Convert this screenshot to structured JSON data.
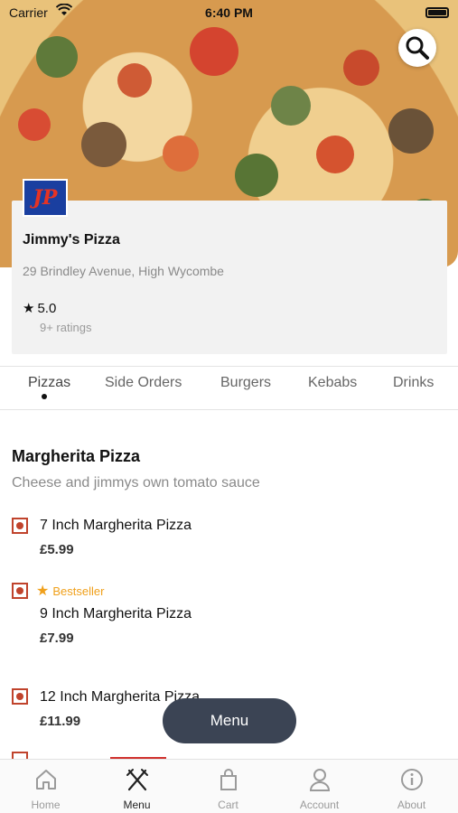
{
  "status_bar": {
    "carrier": "Carrier",
    "time": "6:40 PM"
  },
  "hero": {
    "search_icon": "search-icon"
  },
  "restaurant": {
    "logo_text": "JP",
    "name": "Jimmy's Pizza",
    "address": "29 Brindley Avenue, High Wycombe",
    "rating": "5.0",
    "rating_count": "9+ ratings"
  },
  "tabs": [
    {
      "label": "Pizzas",
      "active": true
    },
    {
      "label": "Side Orders"
    },
    {
      "label": "Burgers"
    },
    {
      "label": "Kebabs"
    },
    {
      "label": "Drinks"
    }
  ],
  "section": {
    "title": "Margherita Pizza",
    "description": "Cheese and jimmys own tomato sauce"
  },
  "items": [
    {
      "name": "7 Inch Margherita Pizza",
      "price": "£5.99"
    },
    {
      "name": "9 Inch Margherita Pizza",
      "price": "£7.99",
      "badge": "Bestseller"
    },
    {
      "name": "12 Inch Margherita Pizza",
      "price": "£11.99"
    }
  ],
  "menu_button": "Menu",
  "bottom_nav": [
    {
      "label": "Home",
      "icon": "home-icon"
    },
    {
      "label": "Menu",
      "icon": "fork-knife-icon",
      "active": true
    },
    {
      "label": "Cart",
      "icon": "bag-icon"
    },
    {
      "label": "Account",
      "icon": "person-icon"
    },
    {
      "label": "About",
      "icon": "info-icon"
    }
  ],
  "colors": {
    "accent": "#d0312d",
    "bestseller": "#f0a01b",
    "veg_mark": "#c0432c",
    "fab": "#3b4454"
  }
}
